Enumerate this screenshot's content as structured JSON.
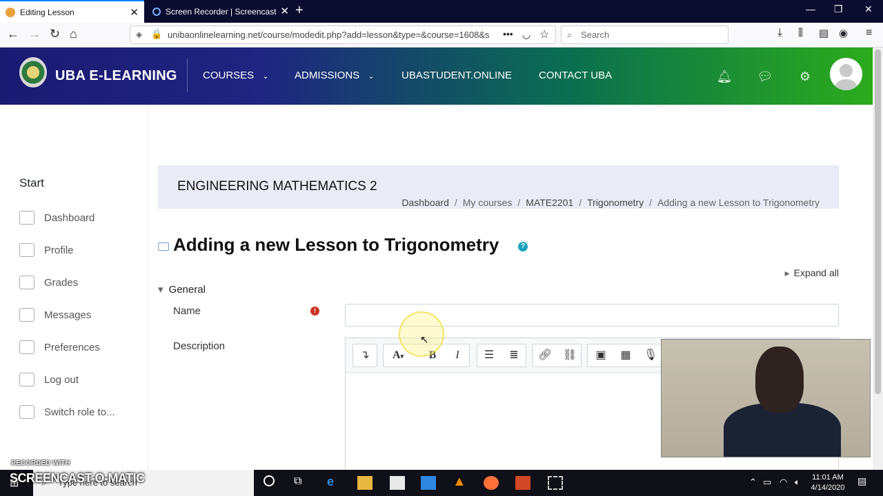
{
  "browser": {
    "tabs": [
      {
        "title": "Editing Lesson",
        "active": true
      },
      {
        "title": "Screen Recorder | Screencast-O",
        "active": false
      }
    ],
    "url": "unibaonlinelearning.net/course/modedit.php?add=lesson&type=&course=1608&s",
    "search_placeholder": "Search",
    "icons": [
      "back-icon",
      "forward-icon",
      "reload-icon",
      "home-icon",
      "shield-icon",
      "ellipsis-icon",
      "pocket-icon",
      "star-icon",
      "download-icon",
      "library-icon",
      "sidebar-icon",
      "account-icon",
      "menu-icon"
    ]
  },
  "site": {
    "brand": "UBA E-LEARNING",
    "menu": [
      {
        "label": "COURSES",
        "dropdown": true
      },
      {
        "label": "ADMISSIONS",
        "dropdown": true
      },
      {
        "label": "UBASTUDENT.ONLINE",
        "dropdown": false
      },
      {
        "label": "CONTACT UBA",
        "dropdown": false
      }
    ],
    "header_icons": [
      "notifications-icon",
      "messages-icon",
      "settings-icon"
    ],
    "colors": {
      "gradient_start": "#1b1a73",
      "gradient_end": "#2cab1c",
      "accent": "#1aa3c1",
      "required": "#ca3120"
    }
  },
  "sidebar": {
    "heading": "Start",
    "items": [
      {
        "label": "Dashboard",
        "icon": "dashboard-icon"
      },
      {
        "label": "Profile",
        "icon": "profile-icon"
      },
      {
        "label": "Grades",
        "icon": "grades-icon"
      },
      {
        "label": "Messages",
        "icon": "messages-icon"
      },
      {
        "label": "Preferences",
        "icon": "preferences-icon"
      },
      {
        "label": "Log out",
        "icon": "logout-icon"
      },
      {
        "label": "Switch role to...",
        "icon": "switch-role-icon"
      }
    ]
  },
  "page": {
    "course_title": "ENGINEERING MATHEMATICS 2",
    "breadcrumb": [
      "Dashboard",
      "My courses",
      "MATE2201",
      "Trigonometry",
      "Adding a new Lesson to Trigonometry"
    ],
    "breadcrumb_sep": "/",
    "title": "Adding a new Lesson to Trigonometry",
    "help": "?",
    "expand_all": "Expand all",
    "section": "General",
    "fields": {
      "name_label": "Name",
      "name_value": "",
      "required_mark": "!",
      "description_label": "Description"
    },
    "editor_toolbar": [
      "collapse-icon",
      "font-color-icon",
      "bold-icon",
      "italic-icon",
      "bullet-list-icon",
      "numbered-list-icon",
      "link-icon",
      "unlink-icon",
      "image-icon",
      "media-icon",
      "record-audio-icon"
    ],
    "editor_text": {
      "bold": "B",
      "italic": "I",
      "font": "A"
    }
  },
  "watermark": {
    "line1": "RECORDED WITH",
    "line2": "SCREENCAST-O-MATIC"
  },
  "taskbar": {
    "search_placeholder": "Type here to search",
    "time": "11:01 AM",
    "date": "4/14/2020"
  }
}
